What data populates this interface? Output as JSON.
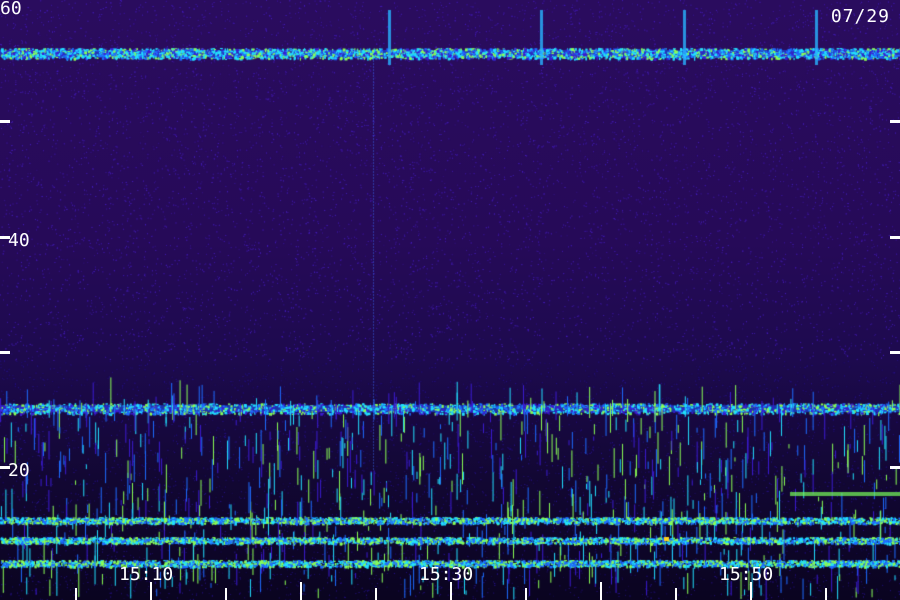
{
  "chart_data": {
    "type": "heatmap",
    "title": "",
    "date_label": "07/29",
    "colormap": [
      "#2a0c5e",
      "#3b1bd0",
      "#1e6cff",
      "#22e0ff",
      "#8bff55",
      "#ffd21f",
      "#ff4a00"
    ],
    "y_axis": {
      "range": [
        0,
        60
      ],
      "major_ticks": [
        20,
        40,
        60
      ],
      "minor_ticks": [
        10,
        30,
        50
      ],
      "tick_labels": [
        "20",
        "40",
        "60"
      ]
    },
    "x_axis": {
      "tick_labels": [
        "15:10",
        "15:30",
        "15:50"
      ]
    },
    "features": [
      {
        "kind": "horizontal-band",
        "level": 55,
        "intensity": 0.8
      },
      {
        "kind": "horizontal-band",
        "level": 18,
        "intensity": 0.55
      },
      {
        "kind": "vertical-line",
        "time": "15:25",
        "intensity": 0.5
      },
      {
        "kind": "low-frequency-activity",
        "below": 12,
        "intensity": 0.6
      }
    ]
  }
}
